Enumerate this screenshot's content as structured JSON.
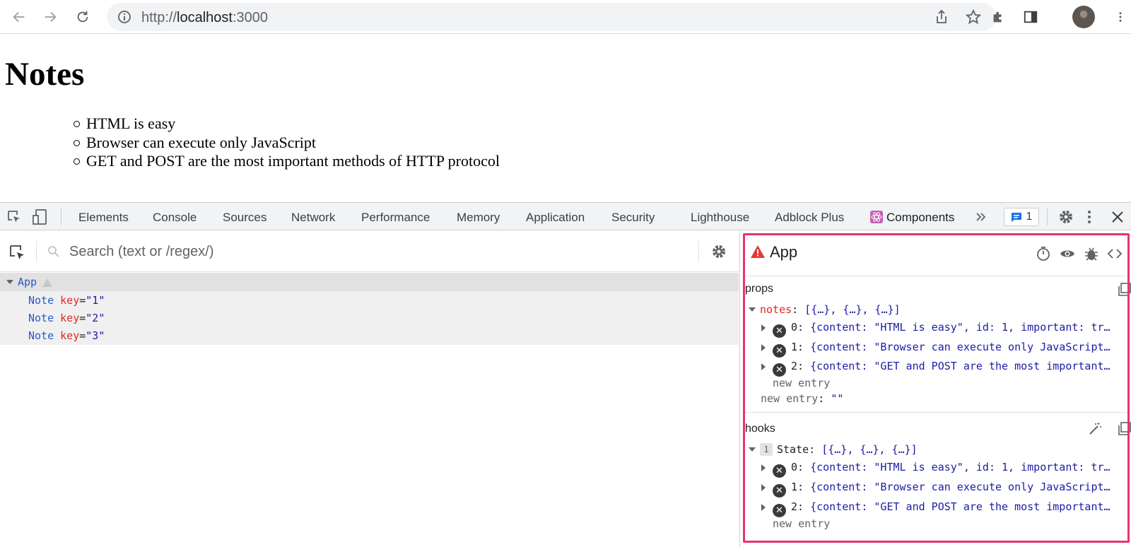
{
  "browser": {
    "url_scheme": "http://",
    "url_host": "localhost",
    "url_port": ":3000"
  },
  "page": {
    "title": "Notes",
    "notes": [
      "HTML is easy",
      "Browser can execute only JavaScript",
      "GET and POST are the most important methods of HTTP protocol"
    ]
  },
  "devtools": {
    "tabs": [
      "Elements",
      "Console",
      "Sources",
      "Network",
      "Performance",
      "Memory",
      "Application",
      "Security",
      "Lighthouse",
      "Adblock Plus",
      "Components"
    ],
    "message_count": "1",
    "accent": "#e8336d"
  },
  "components": {
    "search_placeholder": "Search (text or /regex/)",
    "tree": [
      {
        "name": "App",
        "key": "",
        "val": ""
      },
      {
        "name": "Note",
        "key": "key",
        "val": "\"1\""
      },
      {
        "name": "Note",
        "key": "key",
        "val": "\"2\""
      },
      {
        "name": "Note",
        "key": "key",
        "val": "\"3\""
      }
    ]
  },
  "inspector": {
    "title": "App",
    "props_label": "props",
    "hooks_label": "hooks",
    "notes_key": "notes",
    "notes_summary": "[{…}, {…}, {…}]",
    "entries": [
      {
        "idx": "0:",
        "val": "{content: \"HTML is easy\", id: 1, important: tr…"
      },
      {
        "idx": "1:",
        "val": "{content: \"Browser can execute only JavaScript…"
      },
      {
        "idx": "2:",
        "val": "{content: \"GET and POST are the most important…"
      }
    ],
    "new_entry": "new entry",
    "new_entry_key": "new entry",
    "new_entry_val": "\"\"",
    "hook_id": "1",
    "state_key": "State:",
    "state_summary": "[{…}, {…}, {…}]"
  }
}
